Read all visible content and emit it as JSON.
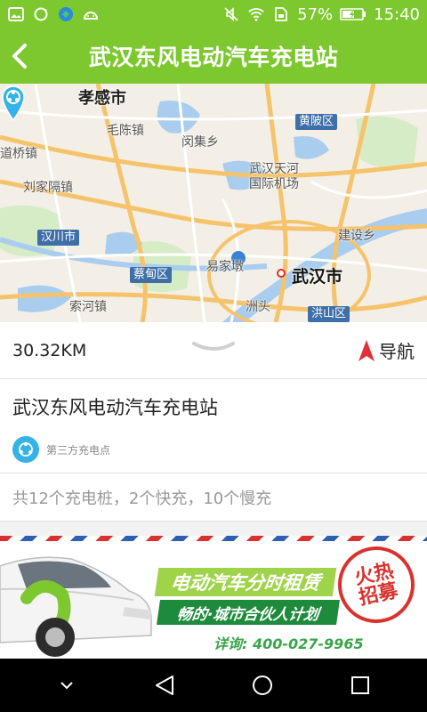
{
  "status_bar": {
    "battery_percent": "57%",
    "time": "15:40",
    "left_icons": [
      "image-icon",
      "sync-icon",
      "app-icon",
      "android-debug-icon"
    ],
    "right_icons": [
      "mute-icon",
      "wifi-icon",
      "sim-icon",
      "battery-icon"
    ]
  },
  "header": {
    "title": "武汉东风电动汽车充电站",
    "back_icon": "back-chevron-icon"
  },
  "map": {
    "labels": {
      "xiaogan": "孝感市",
      "maochen": "毛陈镇",
      "huangpi": "黄陂区",
      "daoqiao": "道桥镇",
      "minji": "闵集乡",
      "liujiagedi": "刘家隔镇",
      "airport": "武汉天河\n国际机场",
      "hanchuan": "汉川市",
      "jianshe": "建设乡",
      "caidian": "蔡甸区",
      "yijiadun": "易家墩",
      "wuhan": "武汉市",
      "suohe": "索河镇",
      "zhoutou": "洲头",
      "hongshan": "洪山区"
    },
    "pin_icon": "location-pin-icon"
  },
  "info": {
    "distance": "30.32KM",
    "nav_label": "导航",
    "nav_icon": "navigation-arrow-icon"
  },
  "station": {
    "name": "武汉东风电动汽车充电站",
    "type_label": "第三方充电点",
    "type_icon": "share-icon"
  },
  "summary": {
    "text": "共12个充电桩，2个快充，10个慢充"
  },
  "banner": {
    "title": "电动汽车分时租赁",
    "subtitle": "畅的·城市合伙人计划",
    "phone": "详询: 400-027-9965",
    "stamp_line1": "火热",
    "stamp_line2": "招募"
  },
  "colors": {
    "brand_green": "#7cc82e",
    "pin_blue": "#35b2e6",
    "nav_red": "#e0313a"
  }
}
